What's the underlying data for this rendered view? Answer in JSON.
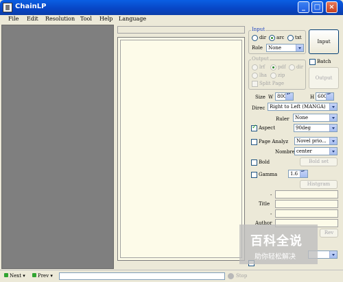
{
  "window": {
    "title": "ChainLP"
  },
  "menu": [
    "File",
    "Edit",
    "Resolution",
    "Tool",
    "Help",
    "Language"
  ],
  "input_group": {
    "legend": "Input",
    "options": [
      "dir",
      "arc",
      "txt"
    ],
    "selected": "arc",
    "role_label": "Role",
    "role_value": "None",
    "input_button": "Input"
  },
  "batch_label": "Batch",
  "output_group": {
    "legend": "Output",
    "options": [
      "lrf",
      "pdf",
      "dir",
      "lha",
      "zip"
    ],
    "selected": "pdf",
    "split_page": "Split Page",
    "output_button": "Output"
  },
  "size": {
    "label": "Size",
    "w_label": "W",
    "w_value": "800",
    "h_label": "H",
    "h_value": "600"
  },
  "direc": {
    "label": "Direc",
    "value": "Right to Left (MANGA)"
  },
  "ruler": {
    "label": "Ruler",
    "value": "None"
  },
  "aspect": {
    "label": "Aspect",
    "checked": true,
    "value": "90deg"
  },
  "page_analyz": {
    "label": "Page Analyz",
    "checked": false,
    "value": "Novel prio..."
  },
  "nombre": {
    "label": "Nombre",
    "value": "center"
  },
  "bold": {
    "label": "Bold",
    "checked": false,
    "button": "Bold set"
  },
  "gamma": {
    "label": "Gamma",
    "checked": false,
    "value": "1.6",
    "button": "Histgram"
  },
  "meta": {
    "dash1": "-",
    "title_label": "Title",
    "dash2": "-",
    "author_label": "Author",
    "rev_button": "Rev"
  },
  "status": {
    "next": "Next",
    "prev": "Prev",
    "stop": "Stop"
  },
  "watermark": {
    "text": "百科全说",
    "sub": "助你轻松解决"
  }
}
